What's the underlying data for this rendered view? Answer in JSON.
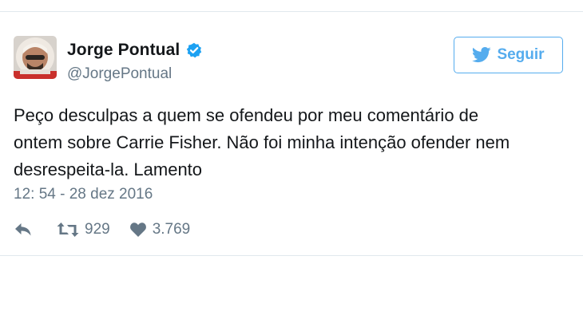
{
  "tweet": {
    "author": {
      "display_name": "Jorge Pontual",
      "handle": "@JorgePontual",
      "verified_icon": "verified-badge-icon",
      "avatar_icon": "avatar-photo"
    },
    "follow_button": {
      "label": "Seguir",
      "icon": "twitter-bird-icon"
    },
    "text_lines": [
      "Peço desculpas a quem se ofendeu por meu comentário de",
      "ontem sobre Carrie Fisher. Não foi minha intenção ofender nem",
      "desrespeita-la. Lamento"
    ],
    "timestamp": "12: 54 - 28 dez 2016",
    "actions": {
      "reply_icon": "reply-icon",
      "retweet_icon": "retweet-icon",
      "retweet_count": "929",
      "like_icon": "heart-icon",
      "like_count": "3.769"
    }
  },
  "colors": {
    "brand_blue": "#55acee",
    "verified_blue": "#1da1f2",
    "muted_text": "#657786",
    "divider": "#e1e8ed"
  }
}
